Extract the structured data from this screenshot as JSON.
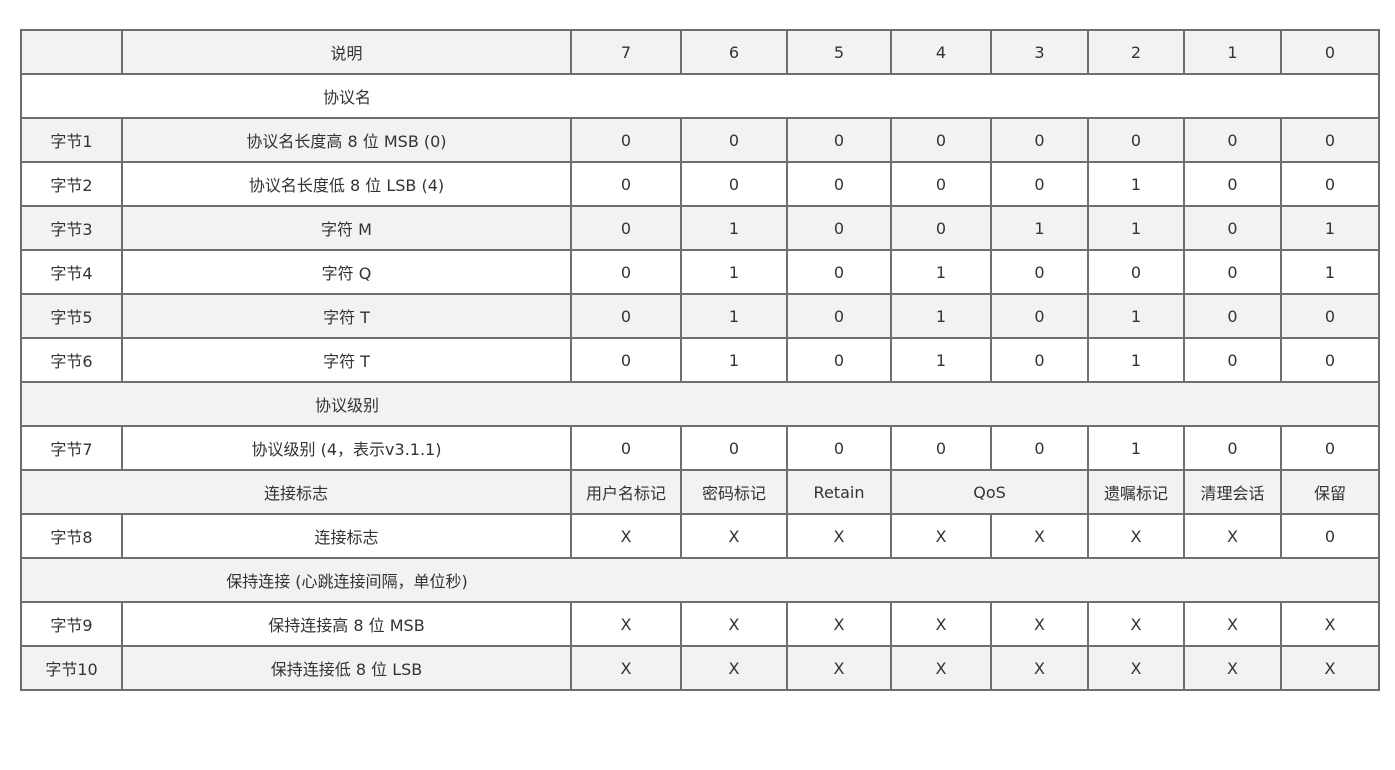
{
  "header": {
    "byte": "",
    "desc": "说明",
    "bits": [
      "7",
      "6",
      "5",
      "4",
      "3",
      "2",
      "1",
      "0"
    ]
  },
  "sections": {
    "protocol_name": "协议名",
    "protocol_level": "协议级别",
    "connect_flags": "连接标志",
    "keep_alive": "保持连接 (心跳连接间隔，单位秒)"
  },
  "rows": [
    {
      "byte": "字节1",
      "desc": "协议名长度高 8 位 MSB (0)",
      "bits": [
        "0",
        "0",
        "0",
        "0",
        "0",
        "0",
        "0",
        "0"
      ]
    },
    {
      "byte": "字节2",
      "desc": "协议名长度低 8 位  LSB (4)",
      "bits": [
        "0",
        "0",
        "0",
        "0",
        "0",
        "1",
        "0",
        "0"
      ]
    },
    {
      "byte": "字节3",
      "desc": "字符 M",
      "bits": [
        "0",
        "1",
        "0",
        "0",
        "1",
        "1",
        "0",
        "1"
      ]
    },
    {
      "byte": "字节4",
      "desc": "字符 Q",
      "bits": [
        "0",
        "1",
        "0",
        "1",
        "0",
        "0",
        "0",
        "1"
      ]
    },
    {
      "byte": "字节5",
      "desc": "字符 T",
      "bits": [
        "0",
        "1",
        "0",
        "1",
        "0",
        "1",
        "0",
        "0"
      ]
    },
    {
      "byte": "字节6",
      "desc": "字符 T",
      "bits": [
        "0",
        "1",
        "0",
        "1",
        "0",
        "1",
        "0",
        "0"
      ]
    },
    {
      "byte": "字节7",
      "desc": "协议级别 (4，表示v3.1.1)",
      "bits": [
        "0",
        "0",
        "0",
        "0",
        "0",
        "1",
        "0",
        "0"
      ]
    },
    {
      "byte": "字节8",
      "desc": "连接标志",
      "bits": [
        "X",
        "X",
        "X",
        "X",
        "X",
        "X",
        "X",
        "0"
      ]
    },
    {
      "byte": "字节9",
      "desc": "保持连接高 8 位 MSB",
      "bits": [
        "X",
        "X",
        "X",
        "X",
        "X",
        "X",
        "X",
        "X"
      ]
    },
    {
      "byte": "字节10",
      "desc": "保持连接低 8 位 LSB",
      "bits": [
        "X",
        "X",
        "X",
        "X",
        "X",
        "X",
        "X",
        "X"
      ]
    }
  ],
  "flag_labels": {
    "bit7": "用户名标记",
    "bit6": "密码标记",
    "bit5": "Retain",
    "bit4_3": "QoS",
    "bit2": "遗嘱标记",
    "bit1": "清理会话",
    "bit0": "保留"
  }
}
